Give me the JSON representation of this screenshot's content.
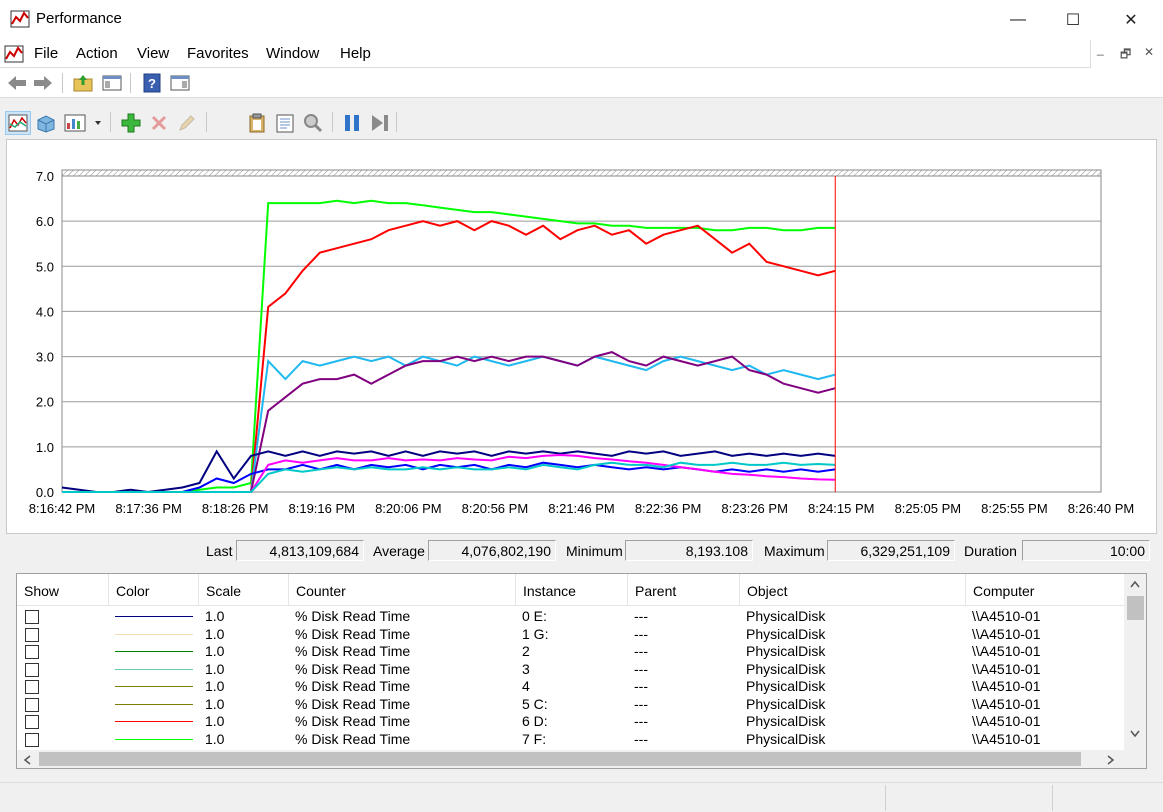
{
  "window": {
    "title": "Performance",
    "minimize_glyph": "—",
    "maximize_glyph": "☐",
    "close_glyph": "✕"
  },
  "menu": [
    "File",
    "Action",
    "View",
    "Favorites",
    "Window",
    "Help"
  ],
  "mdi": {
    "minimize": "_",
    "restore": "🗗",
    "close": "✕"
  },
  "toolbar1": [
    "back-arrow-icon",
    "forward-arrow-icon",
    "folder-up-icon",
    "console-tree-icon",
    "help-icon",
    "action-pane-icon"
  ],
  "toolbar2": [
    "line-graph-view-icon",
    "histogram-view-icon",
    "report-view-icon",
    "change-graph-type-dropdown",
    "add-counter-icon",
    "copy-properties-icon",
    "paste-counter-list-icon",
    "highlight-icon",
    "freeze-display-icon",
    "update-data-icon"
  ],
  "chart_data": {
    "type": "line",
    "ylim": [
      0,
      7
    ],
    "y_ticks": [
      "7.0",
      "6.0",
      "5.0",
      "4.0",
      "3.0",
      "2.0",
      "1.0",
      "0.0"
    ],
    "x_ticks": [
      "8:16:42 PM",
      "8:17:36 PM",
      "8:18:26 PM",
      "8:19:16 PM",
      "8:20:06 PM",
      "8:20:56 PM",
      "8:21:46 PM",
      "8:22:36 PM",
      "8:23:26 PM",
      "8:24:15 PM",
      "8:25:05 PM",
      "8:25:55 PM",
      "8:26:40 PM"
    ],
    "grid": true,
    "current_time_marker": "8:24:15 PM",
    "series": [
      {
        "color": "#00ff00",
        "values": [
          0.0,
          0.0,
          0.0,
          0.0,
          0.0,
          0.0,
          0.0,
          0.0,
          0.05,
          0.1,
          0.1,
          0.2,
          6.4,
          6.4,
          6.4,
          6.4,
          6.45,
          6.4,
          6.45,
          6.4,
          6.4,
          6.35,
          6.3,
          6.25,
          6.2,
          6.2,
          6.15,
          6.1,
          6.05,
          6.0,
          5.95,
          5.95,
          5.9,
          5.9,
          5.85,
          5.85,
          5.85,
          5.85,
          5.8,
          5.8,
          5.85,
          5.85,
          5.8,
          5.8,
          5.85,
          5.85
        ]
      },
      {
        "color": "#ff0000",
        "values": [
          0.0,
          0.0,
          0.0,
          0.0,
          0.0,
          0.0,
          0.0,
          0.0,
          0.0,
          0.0,
          0.0,
          0.0,
          4.1,
          4.4,
          4.9,
          5.3,
          5.4,
          5.5,
          5.6,
          5.8,
          5.9,
          6.0,
          5.9,
          6.0,
          5.8,
          6.0,
          5.9,
          5.7,
          5.9,
          5.6,
          5.8,
          5.9,
          5.7,
          5.8,
          5.5,
          5.7,
          5.8,
          5.9,
          5.6,
          5.3,
          5.5,
          5.1,
          5.0,
          4.9,
          4.8,
          4.9
        ]
      },
      {
        "color": "#20b8f0",
        "values": [
          0.0,
          0.0,
          0.0,
          0.0,
          0.0,
          0.0,
          0.0,
          0.0,
          0.0,
          0.0,
          0.0,
          0.0,
          2.9,
          2.5,
          2.9,
          2.8,
          2.9,
          3.0,
          2.9,
          3.0,
          2.8,
          3.0,
          2.9,
          2.8,
          3.0,
          2.9,
          2.8,
          2.9,
          3.0,
          2.9,
          2.8,
          3.0,
          2.9,
          2.8,
          2.7,
          2.9,
          3.0,
          2.9,
          2.8,
          2.7,
          2.8,
          2.6,
          2.7,
          2.6,
          2.5,
          2.6
        ]
      },
      {
        "color": "#800080",
        "values": [
          0.0,
          0.0,
          0.0,
          0.0,
          0.0,
          0.0,
          0.0,
          0.0,
          0.0,
          0.0,
          0.0,
          0.0,
          1.8,
          2.1,
          2.4,
          2.5,
          2.5,
          2.6,
          2.4,
          2.6,
          2.8,
          2.9,
          2.9,
          3.0,
          2.9,
          3.0,
          2.9,
          3.0,
          3.0,
          2.9,
          2.8,
          3.0,
          3.1,
          2.9,
          2.8,
          3.0,
          2.9,
          2.8,
          2.9,
          3.0,
          2.7,
          2.6,
          2.4,
          2.3,
          2.2,
          2.3
        ]
      },
      {
        "color": "#000080",
        "values": [
          0.1,
          0.05,
          0.0,
          0.0,
          0.05,
          0.0,
          0.05,
          0.1,
          0.2,
          0.9,
          0.3,
          0.8,
          0.9,
          0.8,
          0.9,
          0.8,
          0.9,
          0.85,
          0.9,
          0.8,
          0.9,
          0.8,
          0.9,
          0.85,
          0.9,
          0.8,
          0.9,
          0.85,
          0.9,
          0.85,
          0.9,
          0.85,
          0.8,
          0.9,
          0.85,
          0.9,
          0.8,
          0.85,
          0.9,
          0.8,
          0.85,
          0.8,
          0.85,
          0.8,
          0.85,
          0.8
        ]
      },
      {
        "color": "#0000ff",
        "values": [
          0.0,
          0.0,
          0.0,
          0.0,
          0.0,
          0.0,
          0.0,
          0.0,
          0.1,
          0.3,
          0.2,
          0.4,
          0.5,
          0.5,
          0.6,
          0.5,
          0.6,
          0.5,
          0.6,
          0.55,
          0.6,
          0.5,
          0.6,
          0.55,
          0.6,
          0.5,
          0.6,
          0.55,
          0.65,
          0.6,
          0.55,
          0.6,
          0.55,
          0.5,
          0.55,
          0.5,
          0.55,
          0.5,
          0.45,
          0.5,
          0.45,
          0.5,
          0.45,
          0.5,
          0.45,
          0.5
        ]
      },
      {
        "color": "#ff00ff",
        "values": [
          0.0,
          0.0,
          0.0,
          0.0,
          0.0,
          0.0,
          0.0,
          0.0,
          0.0,
          0.0,
          0.0,
          0.0,
          0.6,
          0.7,
          0.65,
          0.7,
          0.75,
          0.7,
          0.7,
          0.75,
          0.7,
          0.72,
          0.7,
          0.75,
          0.72,
          0.7,
          0.78,
          0.75,
          0.8,
          0.82,
          0.8,
          0.75,
          0.72,
          0.68,
          0.65,
          0.6,
          0.55,
          0.5,
          0.45,
          0.4,
          0.38,
          0.35,
          0.33,
          0.3,
          0.28,
          0.27
        ]
      },
      {
        "color": "#00c8c8",
        "values": [
          0.0,
          0.0,
          0.0,
          0.0,
          0.0,
          0.0,
          0.0,
          0.0,
          0.0,
          0.0,
          0.0,
          0.0,
          0.4,
          0.5,
          0.45,
          0.5,
          0.55,
          0.5,
          0.55,
          0.5,
          0.5,
          0.55,
          0.5,
          0.55,
          0.5,
          0.5,
          0.55,
          0.5,
          0.6,
          0.55,
          0.5,
          0.6,
          0.65,
          0.6,
          0.6,
          0.55,
          0.65,
          0.6,
          0.6,
          0.65,
          0.6,
          0.6,
          0.65,
          0.6,
          0.62,
          0.6
        ]
      }
    ]
  },
  "stats": {
    "last_label": "Last",
    "last": "4,813,109,684",
    "average_label": "Average",
    "average": "4,076,802,190",
    "minimum_label": "Minimum",
    "minimum": "8,193.108",
    "maximum_label": "Maximum",
    "maximum": "6,329,251,109",
    "duration_label": "Duration",
    "duration": "10:00"
  },
  "legend": {
    "headers": [
      "Show",
      "Color",
      "Scale",
      "Counter",
      "Instance",
      "Parent",
      "Object",
      "Computer"
    ],
    "rows": [
      {
        "color": "#000080",
        "scale": "1.0",
        "counter": "% Disk Read Time",
        "instance": "0 E:",
        "parent": "---",
        "object": "PhysicalDisk",
        "computer": "\\\\A4510-01"
      },
      {
        "color": "#f5deb3",
        "scale": "1.0",
        "counter": "% Disk Read Time",
        "instance": "1 G:",
        "parent": "---",
        "object": "PhysicalDisk",
        "computer": "\\\\A4510-01"
      },
      {
        "color": "#008000",
        "scale": "1.0",
        "counter": "% Disk Read Time",
        "instance": "2",
        "parent": "---",
        "object": "PhysicalDisk",
        "computer": "\\\\A4510-01"
      },
      {
        "color": "#66cdaa",
        "scale": "1.0",
        "counter": "% Disk Read Time",
        "instance": "3",
        "parent": "---",
        "object": "PhysicalDisk",
        "computer": "\\\\A4510-01"
      },
      {
        "color": "#808000",
        "scale": "1.0",
        "counter": "% Disk Read Time",
        "instance": "4",
        "parent": "---",
        "object": "PhysicalDisk",
        "computer": "\\\\A4510-01"
      },
      {
        "color": "#808000",
        "scale": "1.0",
        "counter": "% Disk Read Time",
        "instance": "5 C:",
        "parent": "---",
        "object": "PhysicalDisk",
        "computer": "\\\\A4510-01"
      },
      {
        "color": "#ff0000",
        "scale": "1.0",
        "counter": "% Disk Read Time",
        "instance": "6 D:",
        "parent": "---",
        "object": "PhysicalDisk",
        "computer": "\\\\A4510-01"
      },
      {
        "color": "#00ff00",
        "scale": "1.0",
        "counter": "% Disk Read Time",
        "instance": "7 F:",
        "parent": "---",
        "object": "PhysicalDisk",
        "computer": "\\\\A4510-01"
      }
    ]
  }
}
